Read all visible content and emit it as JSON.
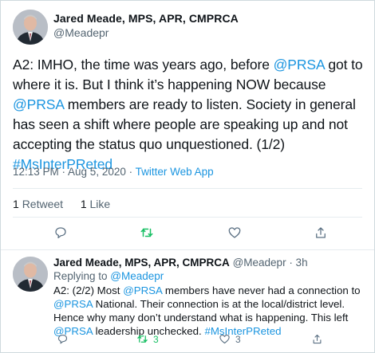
{
  "main": {
    "display_name": "Jared Meade, MPS, APR, CMPRCA",
    "handle": "@Meadepr",
    "text_parts": [
      {
        "t": "A2: IMHO, the time was years ago, before ",
        "link": false
      },
      {
        "t": "@PRSA",
        "link": true
      },
      {
        "t": " got to where it is. But I think it’s happening NOW because ",
        "link": false
      },
      {
        "t": "@PRSA",
        "link": true
      },
      {
        "t": " members are ready to listen. Society in general has seen a shift where people are speaking up and not accepting the status quo unquestioned. (1/2) ",
        "link": false
      },
      {
        "t": "#MsInterPReted",
        "link": true
      }
    ],
    "time": "12:13 PM · Aug 5, 2020 · ",
    "source": "Twitter Web App",
    "retweets_count": "1",
    "retweets_label": "Retweet",
    "likes_count": "1",
    "likes_label": "Like"
  },
  "reply": {
    "display_name": "Jared Meade, MPS, APR, CMPRCA",
    "handle_time": "@Meadepr · 3h",
    "replying_prefix": "Replying to ",
    "replying_to": "@Meadepr",
    "text_parts": [
      {
        "t": "A2: (2/2) Most ",
        "link": false
      },
      {
        "t": "@PRSA",
        "link": true
      },
      {
        "t": " members have never had a connection to ",
        "link": false
      },
      {
        "t": "@PRSA",
        "link": true
      },
      {
        "t": " National. Their connection is at the local/district level. Hence why many don’t understand what is happening. This left ",
        "link": false
      },
      {
        "t": "@PRSA",
        "link": true
      },
      {
        "t": " leadership unchecked. ",
        "link": false
      },
      {
        "t": "#MsInterPReted",
        "link": true
      }
    ],
    "retweet_count": "3",
    "like_count": "3"
  },
  "colors": {
    "link": "#1b95e0",
    "retweet_active": "#17bf63",
    "muted": "#536471",
    "icon": "#5b7083"
  },
  "icons": [
    "reply-icon",
    "retweet-icon",
    "like-icon",
    "share-icon"
  ]
}
